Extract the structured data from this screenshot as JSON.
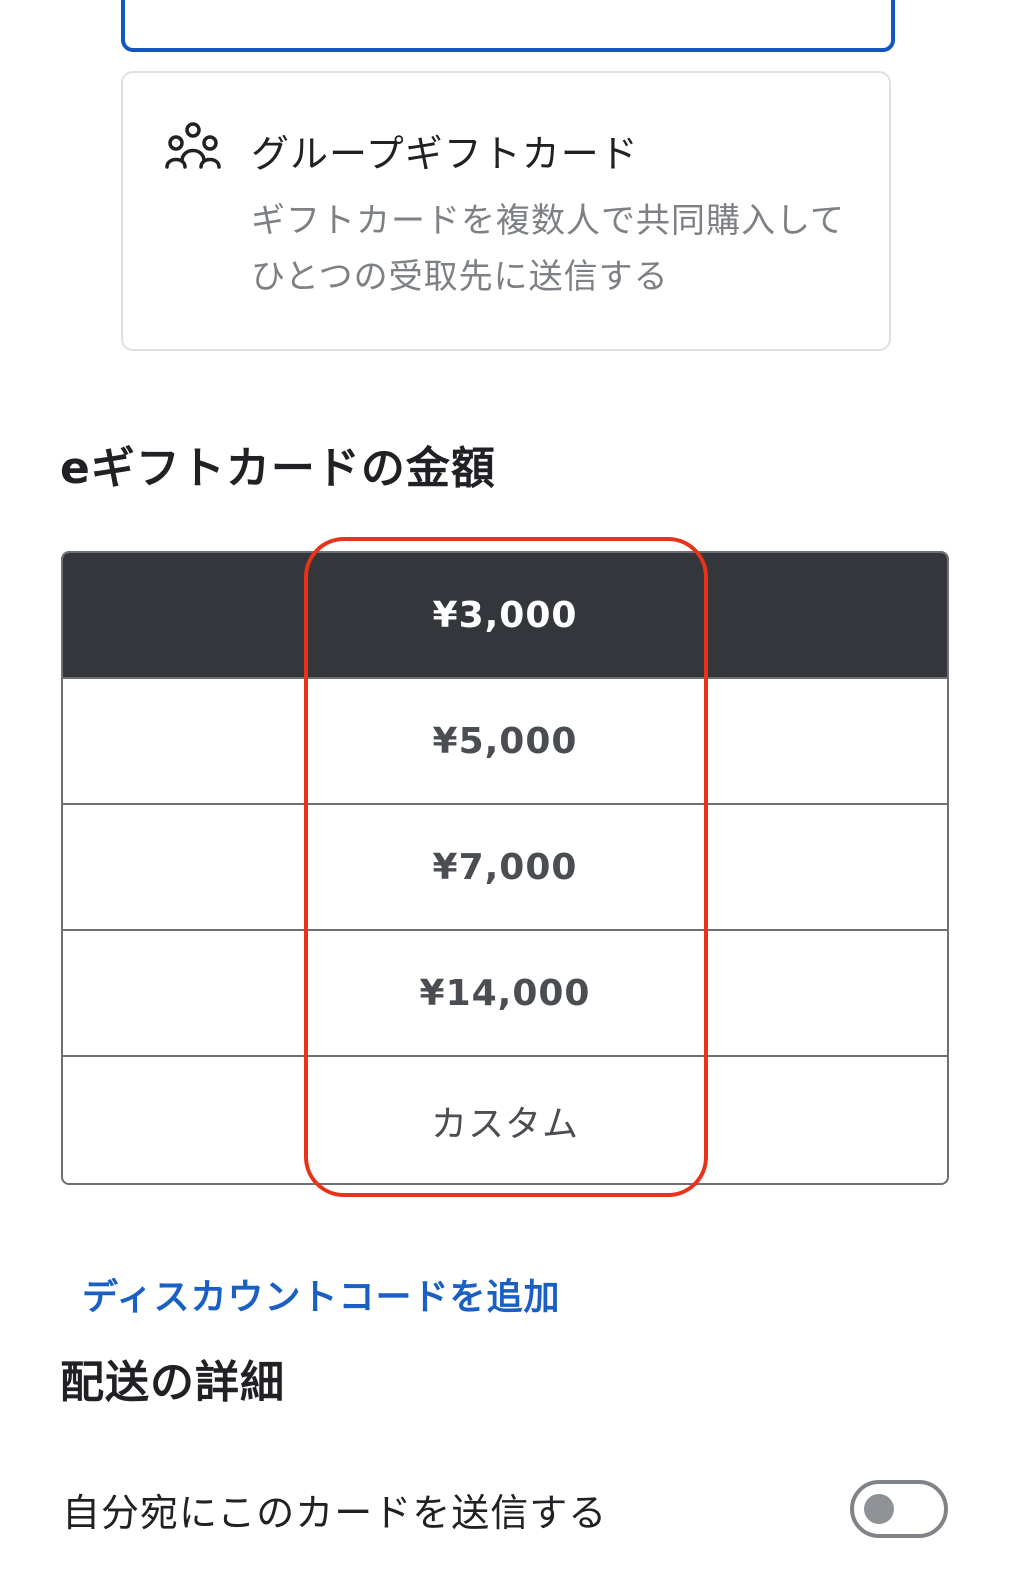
{
  "group_card": {
    "icon": "group-people-icon",
    "title": "グループギフトカード",
    "description": "ギフトカードを複数人で共同購入してひとつの受取先に送信する"
  },
  "amount_section": {
    "title": "eギフトカードの金額",
    "options": [
      "¥3,000",
      "¥5,000",
      "¥7,000",
      "¥14,000",
      "カスタム"
    ],
    "selected_index": 0
  },
  "discount_link": "ディスカウントコードを追加",
  "delivery_section": {
    "title": "配送の詳細",
    "send_to_self_label": "自分宛にこのカードを送信する",
    "send_to_self_enabled": false
  },
  "colors": {
    "selected_border": "#1457c0",
    "selected_amount_bg": "#33373b",
    "link": "#1a5fc4",
    "highlight": "#e8321a"
  }
}
